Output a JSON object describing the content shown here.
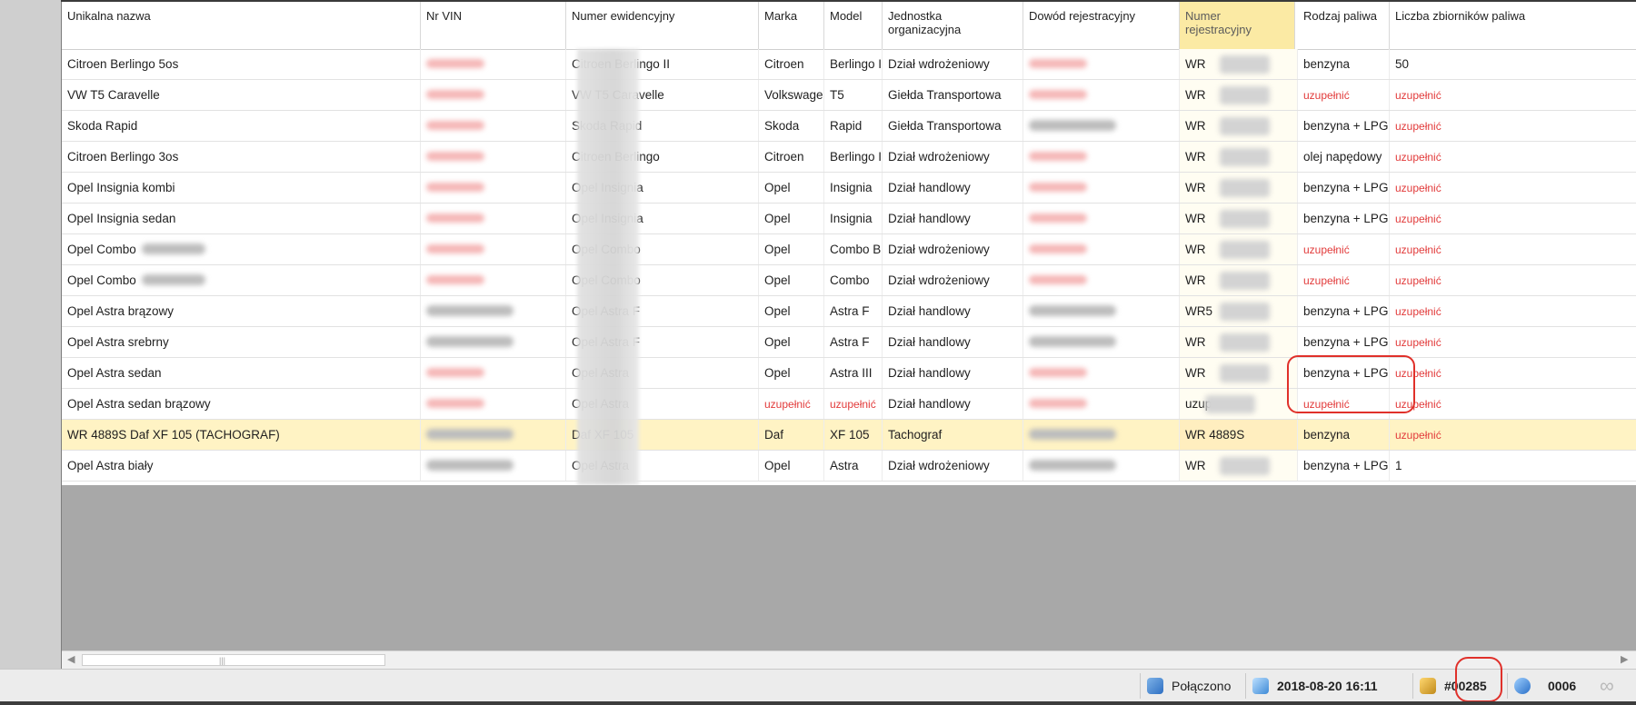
{
  "columns": [
    {
      "key": "name",
      "label": "Unikalna nazwa"
    },
    {
      "key": "vin",
      "label": "Nr VIN"
    },
    {
      "key": "ev",
      "label": "Numer ewidencyjny"
    },
    {
      "key": "make",
      "label": "Marka"
    },
    {
      "key": "model",
      "label": "Model"
    },
    {
      "key": "unit",
      "label": "Jednostka organizacyjna"
    },
    {
      "key": "doc",
      "label": "Dowód rejestracyjny"
    },
    {
      "key": "reg",
      "label": "Numer rejestracyjny"
    },
    {
      "key": "fuel",
      "label": "Rodzaj paliwa"
    },
    {
      "key": "tanks",
      "label": "Liczba zbiorników paliwa"
    }
  ],
  "rows": [
    {
      "name": "Citroen Berlingo 5os",
      "vin": "red",
      "ev": "Citroen Berlingo II",
      "make": "Citroen",
      "model": "Berlingo II",
      "unit": "Dział wdrożeniowy",
      "doc": "red",
      "reg": "WR",
      "fuel": "benzyna",
      "tanks": "50"
    },
    {
      "name": "VW T5 Caravelle",
      "vin": "red",
      "ev": "VW T5 Caravelle",
      "make": "Volkswagen",
      "model": "T5",
      "unit": "Giełda Transportowa",
      "doc": "red",
      "reg": "WR",
      "fuel": "uzupełnić",
      "tanks": "uzupełnić"
    },
    {
      "name": "Skoda Rapid",
      "vin": "red",
      "ev": "Skoda Rapid",
      "make": "Skoda",
      "model": "Rapid",
      "unit": "Giełda Transportowa",
      "doc": "gray",
      "reg": "WR",
      "fuel": "benzyna + LPG",
      "tanks": "uzupełnić"
    },
    {
      "name": "Citroen Berlingo 3os",
      "vin": "red",
      "ev": "Citroen Berlingo",
      "make": "Citroen",
      "model": "Berlingo II",
      "unit": "Dział wdrożeniowy",
      "doc": "red",
      "reg": "WR",
      "fuel": "olej napędowy",
      "tanks": "uzupełnić"
    },
    {
      "name": "Opel Insignia kombi",
      "vin": "red",
      "ev": "Opel Insignia",
      "make": "Opel",
      "model": "Insignia",
      "unit": "Dział handlowy",
      "doc": "red",
      "reg": "WR",
      "fuel": "benzyna + LPG",
      "tanks": "uzupełnić"
    },
    {
      "name": "Opel Insignia sedan",
      "vin": "red",
      "ev": "Opel Insignia",
      "make": "Opel",
      "model": "Insignia",
      "unit": "Dział handlowy",
      "doc": "red",
      "reg": "WR",
      "fuel": "benzyna + LPG",
      "tanks": "uzupełnić"
    },
    {
      "name": "Opel Combo",
      "vin": "red",
      "ev": "Opel Combo",
      "make": "Opel",
      "model": "Combo B",
      "unit": "Dział wdrożeniowy",
      "doc": "red",
      "reg": "WR",
      "fuel": "uzupełnić",
      "tanks": "uzupełnić"
    },
    {
      "name": "Opel Combo",
      "vin": "red",
      "ev": "Opel Combo",
      "make": "Opel",
      "model": "Combo",
      "unit": "Dział wdrożeniowy",
      "doc": "red",
      "reg": "WR",
      "fuel": "uzupełnić",
      "tanks": "uzupełnić"
    },
    {
      "name": "Opel Astra brązowy",
      "vin": "gray",
      "ev": "Opel Astra F",
      "make": "Opel",
      "model": "Astra F",
      "unit": "Dział handlowy",
      "doc": "gray",
      "reg": "WR5",
      "fuel": "benzyna + LPG",
      "tanks": "uzupełnić"
    },
    {
      "name": "Opel Astra srebrny",
      "vin": "gray",
      "ev": "Opel Astra F",
      "make": "Opel",
      "model": "Astra F",
      "unit": "Dział handlowy",
      "doc": "gray",
      "reg": "WR",
      "fuel": "benzyna + LPG",
      "tanks": "uzupełnić"
    },
    {
      "name": "Opel Astra sedan",
      "vin": "red",
      "ev": "Opel Astra",
      "make": "Opel",
      "model": "Astra III",
      "unit": "Dział handlowy",
      "doc": "red",
      "reg": "WR",
      "fuel": "benzyna + LPG",
      "tanks": "uzupełnić"
    },
    {
      "name": "Opel Astra sedan brązowy",
      "vin": "red",
      "ev": "Opel Astra",
      "make": "uzupełnić",
      "model": "uzupełnić",
      "unit": "Dział handlowy",
      "doc": "red",
      "reg": "uzup",
      "fuel": "uzupełnić",
      "tanks": "uzupełnić"
    },
    {
      "name": "WR 4889S Daf XF 105 (TACHOGRAF)",
      "vin": "gray",
      "ev": "Daf XF 105",
      "make": "Daf",
      "model": "XF 105",
      "unit": "Tachograf",
      "doc": "gray",
      "reg": "WR 4889S",
      "fuel": "benzyna",
      "tanks": "uzupełnić"
    },
    {
      "name": "Opel Astra biały",
      "vin": "gray",
      "ev": "Opel Astra",
      "make": "Opel",
      "model": "Astra",
      "unit": "Dział wdrożeniowy",
      "doc": "gray",
      "reg": "WR",
      "fuel": "benzyna + LPG",
      "tanks": "1"
    }
  ],
  "selected_row": 12,
  "status": {
    "connection": "Połączono",
    "datetime": "2018-08-20 16:11",
    "record": "#00285",
    "count": "0006"
  },
  "colors": {
    "missing_value": "#e23b3b",
    "sorted_header": "#fbeaa4",
    "selected_row": "#fff3c4",
    "highlight_ring": "#e0302a"
  },
  "icons": {
    "connection": "network-connected-icon",
    "datetime": "clock-sync-icon",
    "record": "package-icon",
    "count": "info-cube-icon",
    "loop": "infinity-icon"
  }
}
